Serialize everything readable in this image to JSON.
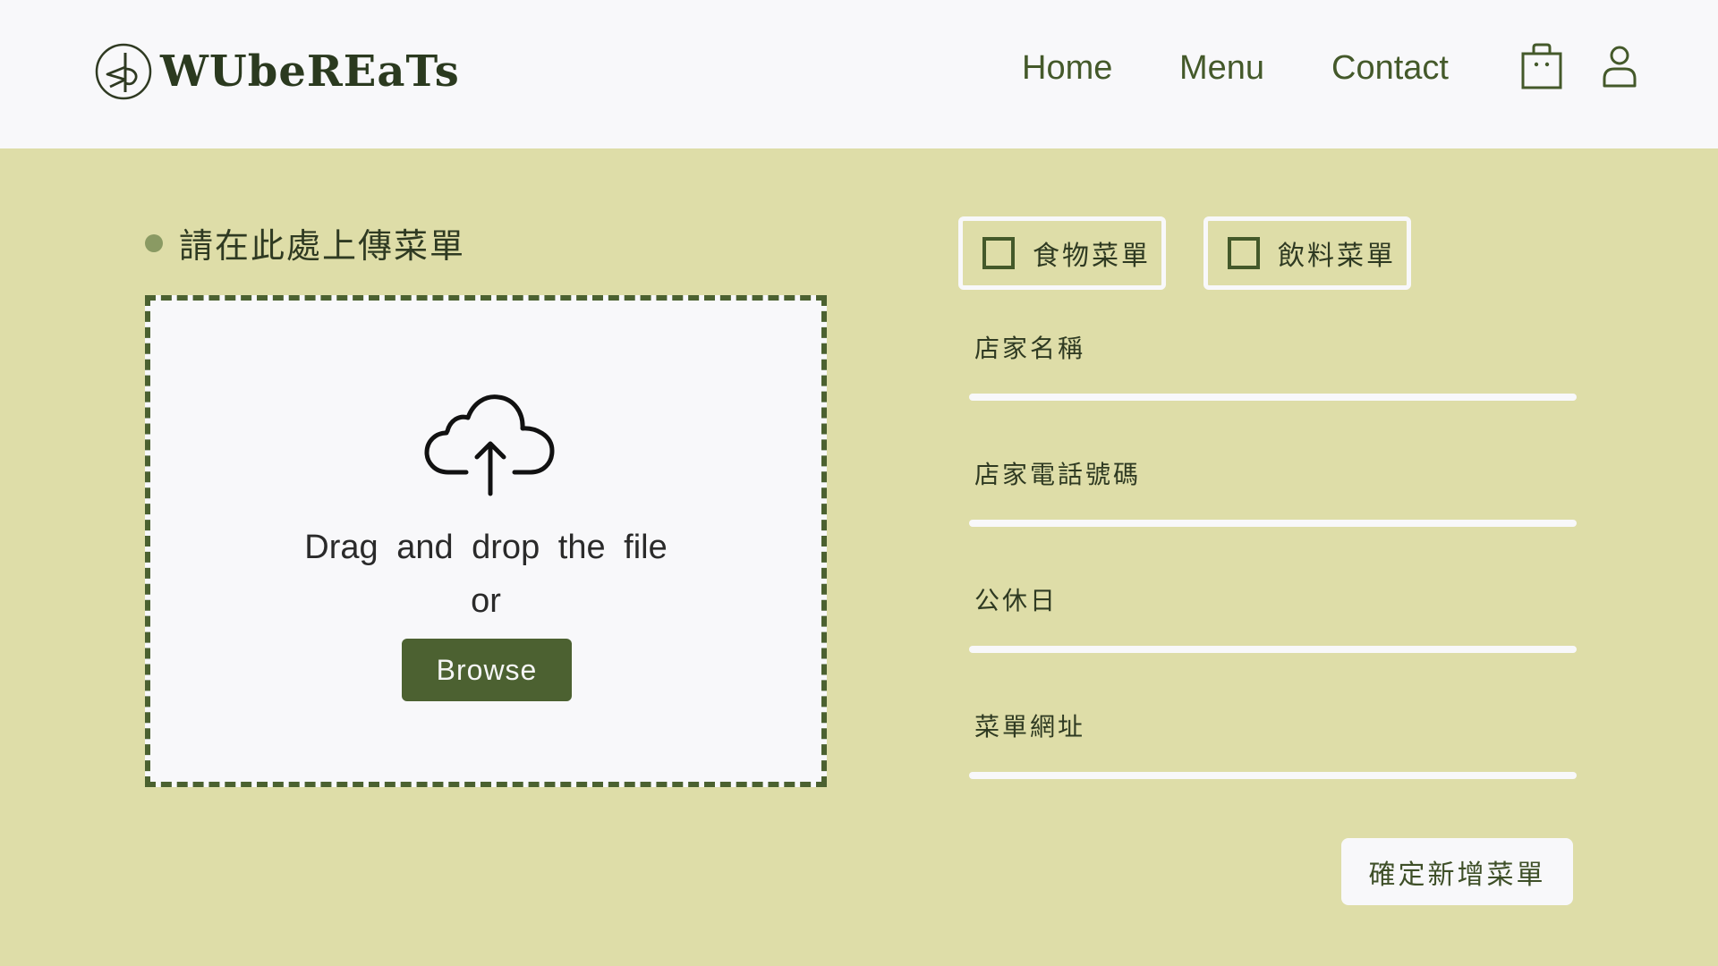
{
  "header": {
    "logo_text": "WUbeREaTs",
    "nav": {
      "home": "Home",
      "menu": "Menu",
      "contact": "Contact"
    },
    "icons": [
      "logo-emblem-icon",
      "shopping-bag-icon",
      "user-icon"
    ]
  },
  "upload": {
    "title": "請在此處上傳菜單",
    "drag_text": "Drag and drop the file",
    "or_text": "or",
    "browse_label": "Browse",
    "icon": "cloud-upload-icon"
  },
  "menu_type": {
    "food_label": "食物菜單",
    "drink_label": "飲料菜單",
    "food_checked": false,
    "drink_checked": false
  },
  "form": {
    "store_name_label": "店家名稱",
    "store_phone_label": "店家電話號碼",
    "day_off_label": "公休日",
    "menu_url_label": "菜單網址",
    "store_name_value": "",
    "store_phone_value": "",
    "day_off_value": "",
    "menu_url_value": "",
    "submit_label": "確定新增菜單"
  },
  "colors": {
    "page_bg": "#dedda8",
    "header_bg": "#f8f8fa",
    "accent": "#4c6131",
    "nav_text": "#44592a"
  }
}
